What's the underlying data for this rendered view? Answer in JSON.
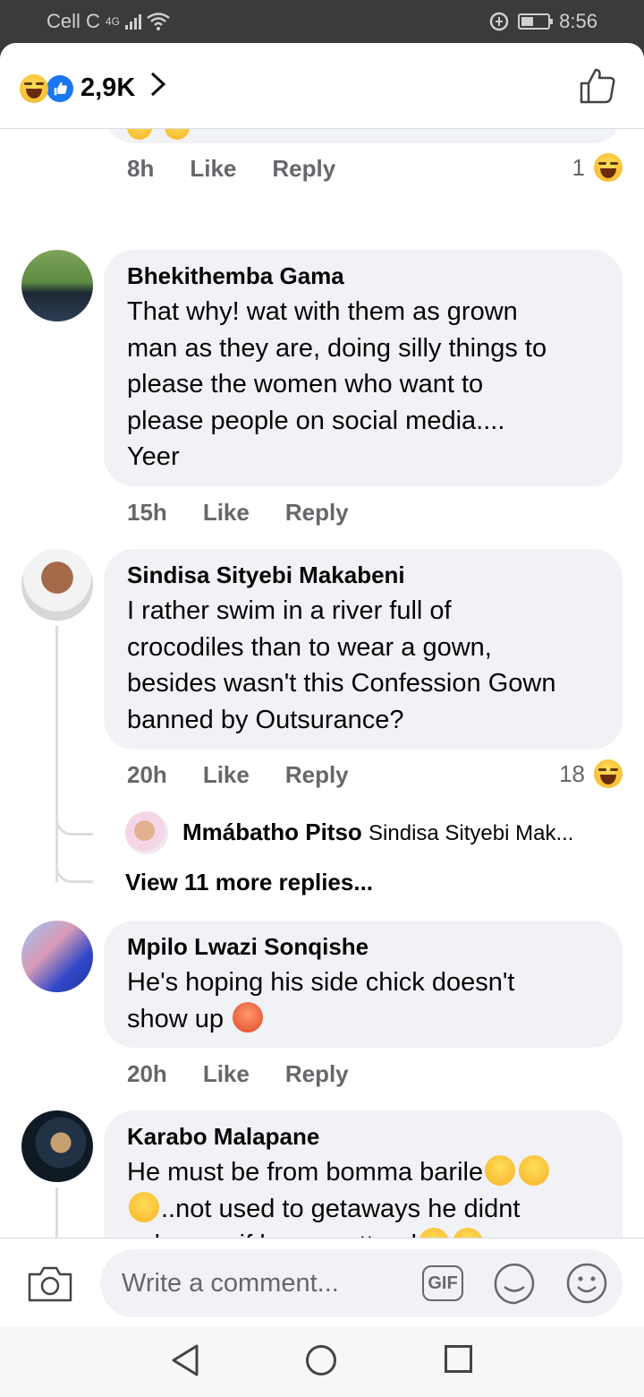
{
  "status_bar": {
    "carrier": "Cell C",
    "network": "4G",
    "time": "8:56"
  },
  "header": {
    "reaction_count": "2,9K",
    "chevron": ">",
    "like_button_icon": "thumbs-up-icon"
  },
  "previous_comment": {
    "time": "8h",
    "like": "Like",
    "reply": "Reply",
    "reaction_count": "1"
  },
  "comments": [
    {
      "author": "Bhekithemba Gama",
      "text_lines": [
        "That why! wat with them as grown",
        "man as they are, doing silly things to",
        "please the women who want to",
        "please people on social media....",
        "Yeer"
      ],
      "time": "15h",
      "like": "Like",
      "reply": "Reply"
    },
    {
      "author": "Sindisa Sityebi Makabeni",
      "text_lines": [
        "I rather swim in a river full of",
        "crocodiles than to wear a gown,",
        "besides wasn't this Confession Gown",
        "banned by Outsurance?"
      ],
      "time": "20h",
      "like": "Like",
      "reply": "Reply",
      "reaction_count": "18",
      "reply_preview": {
        "author": "Mmábatho Pitso",
        "text": "Sindisa Sityebi Mak..."
      },
      "view_more": "View 11 more replies..."
    },
    {
      "author": "Mpilo Lwazi Sonqishe",
      "text_lines": [
        "He's hoping his side chick doesn't",
        "show up"
      ],
      "time": "20h",
      "like": "Like",
      "reply": "Reply"
    },
    {
      "author": "Karabo Malapane",
      "text_lines": [
        "He must be from bomma barile",
        "..not used to getaways he didnt",
        "ask mma if he can attend"
      ]
    }
  ],
  "composer": {
    "placeholder": "Write a comment...",
    "gif_label": "GIF"
  },
  "colors": {
    "bubble": "#f0f2f5",
    "meta_text": "#65676b",
    "like_blue": "#1877f2",
    "haha_yellow": "#f7b125"
  }
}
